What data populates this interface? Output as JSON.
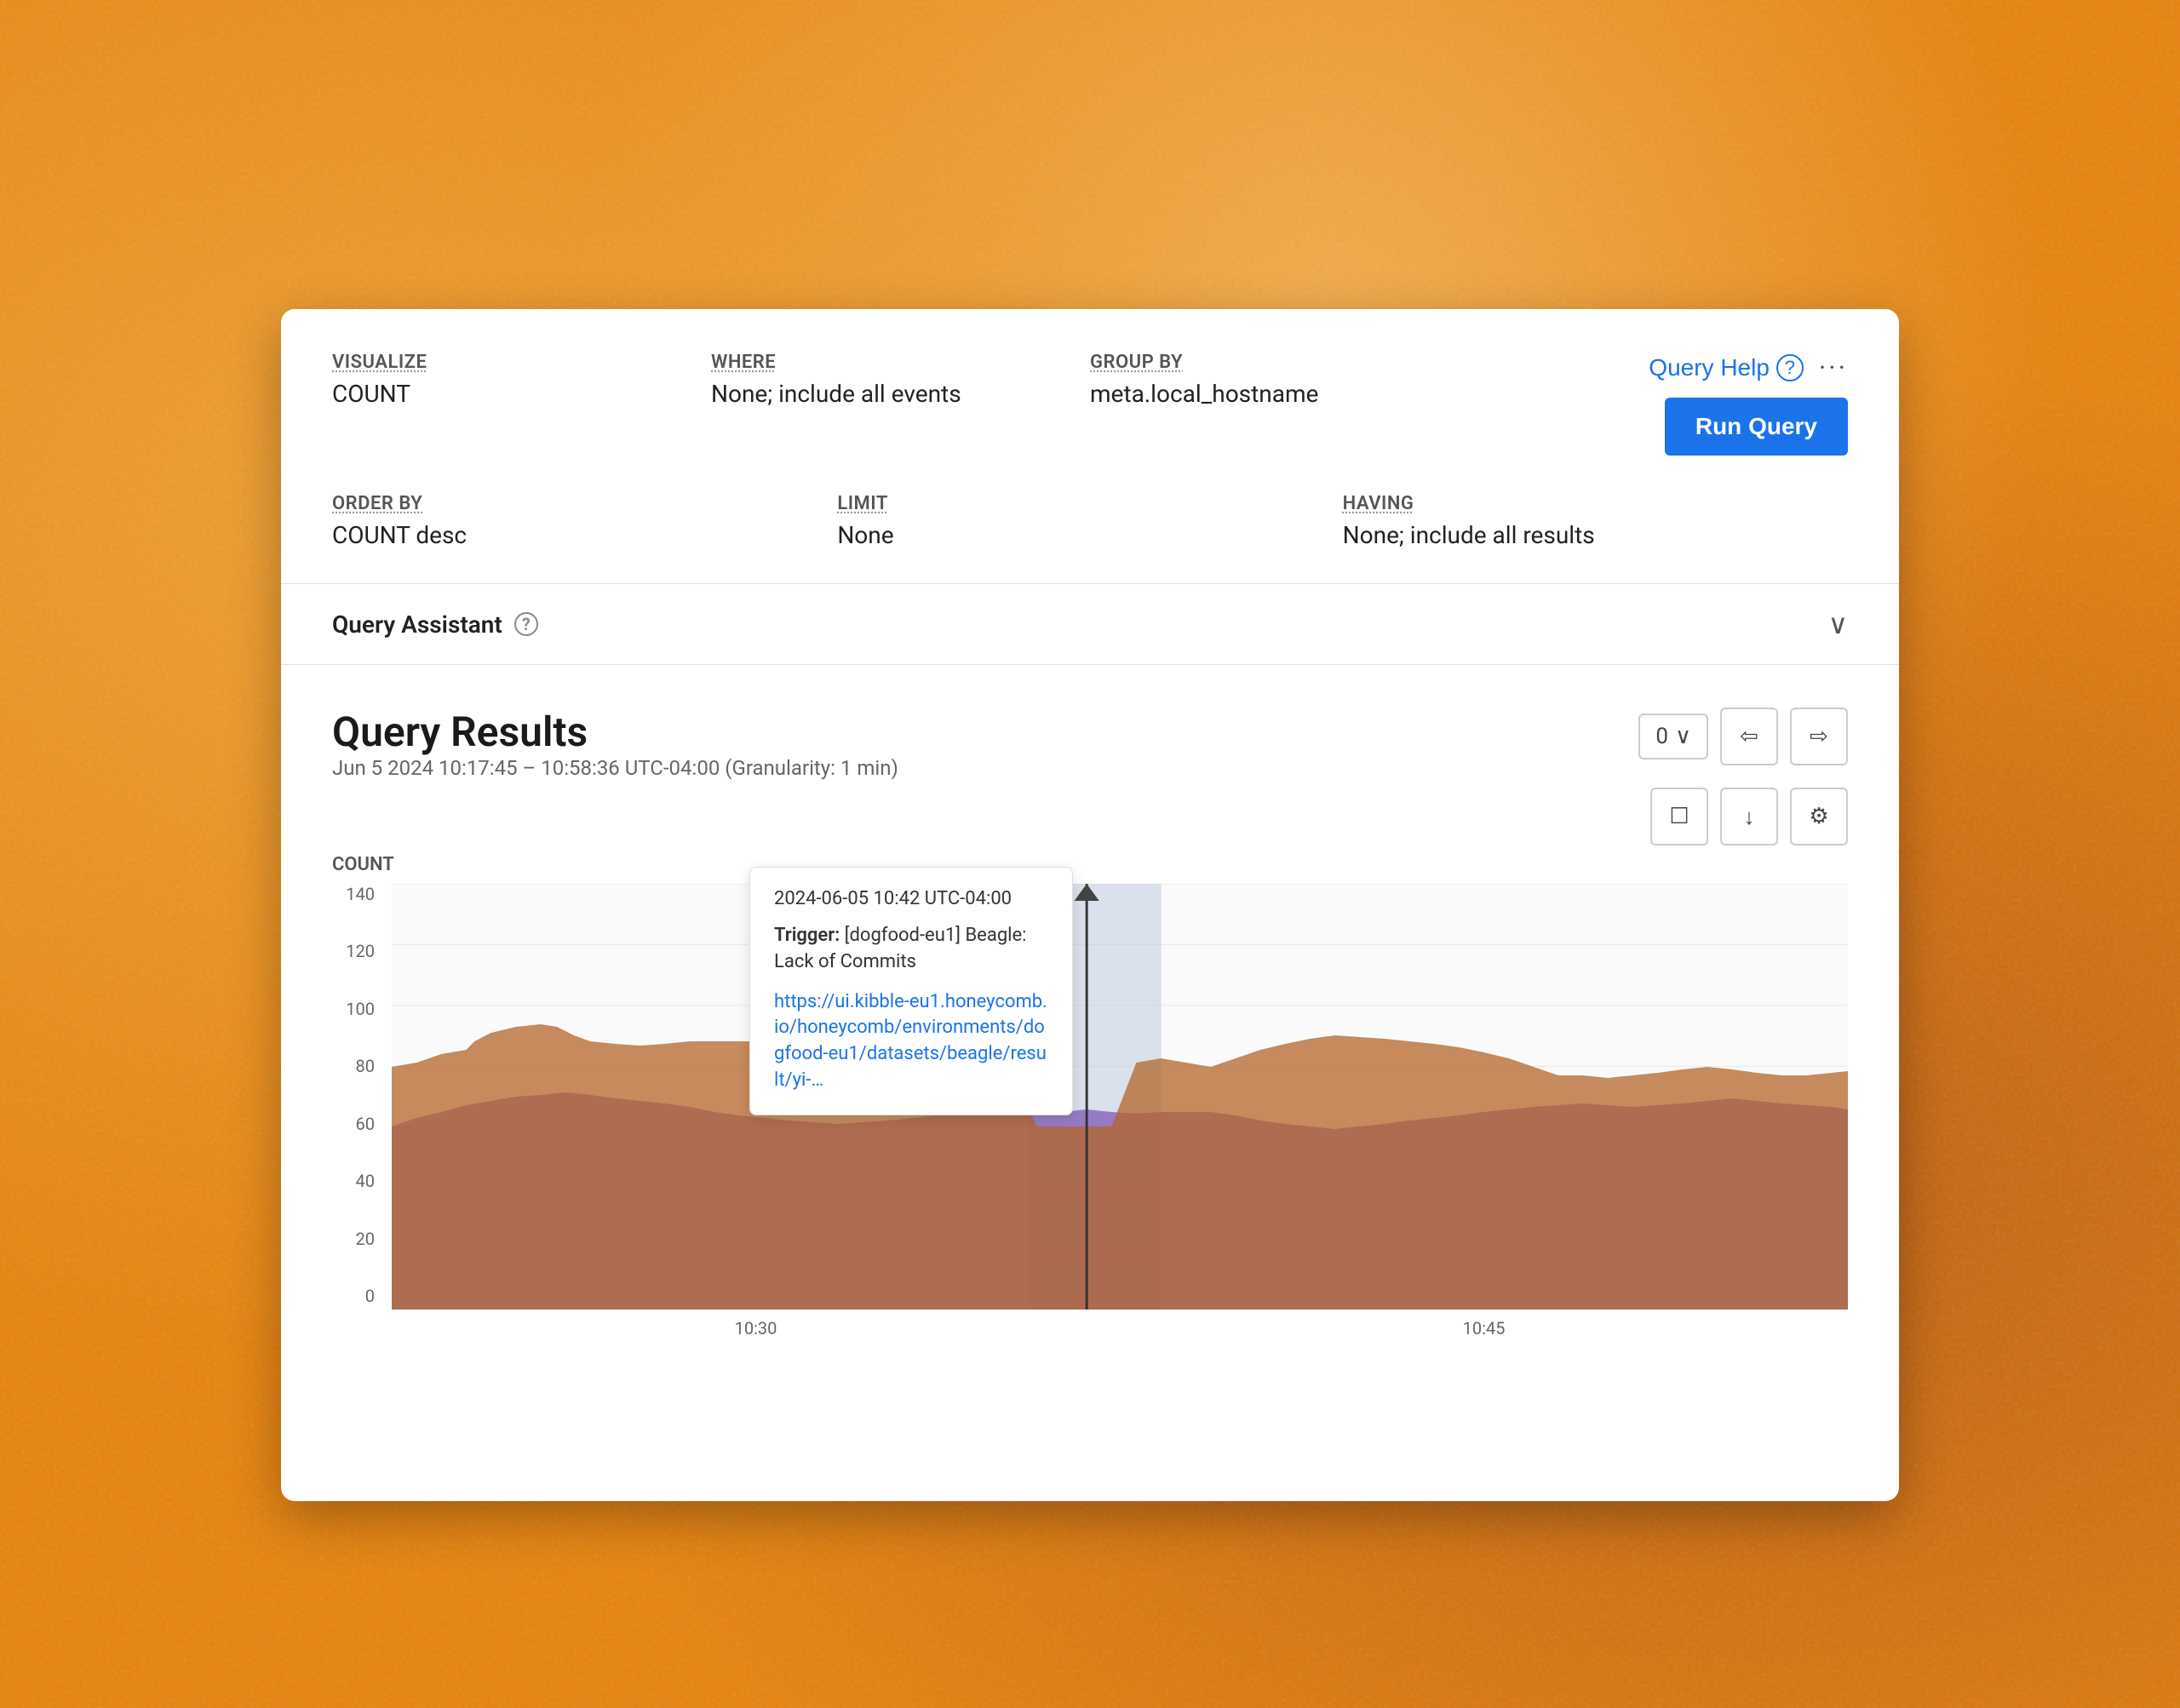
{
  "queryBuilder": {
    "visualize": {
      "label": "VISUALIZE",
      "value": "COUNT"
    },
    "where": {
      "label": "WHERE",
      "value": "None; include all events"
    },
    "groupBy": {
      "label": "GROUP BY",
      "value": "meta.local_hostname"
    },
    "orderBy": {
      "label": "ORDER BY",
      "value": "COUNT desc"
    },
    "limit": {
      "label": "LIMIT",
      "value": "None"
    },
    "having": {
      "label": "HAVING",
      "value": "None; include all results"
    },
    "queryHelp": "Query Help",
    "moreOptions": "···",
    "runQuery": "Run Query"
  },
  "queryAssistant": {
    "title": "Query Assistant",
    "helpIcon": "?"
  },
  "queryResults": {
    "title": "Query Results",
    "subtitle": "Jun 5 2024 10:17:45 – 10:58:36 UTC-04:00 (Granularity: 1 min)",
    "chartYLabel": "COUNT",
    "controls": {
      "pageSize": "0",
      "checkboxIcon": "☐",
      "downloadIcon": "↓",
      "settingsIcon": "⚙",
      "prevIcon": "◁",
      "nextIcon": "▷"
    }
  },
  "chart": {
    "yAxisTicks": [
      "0",
      "20",
      "40",
      "60",
      "80",
      "100",
      "120",
      "140"
    ],
    "xAxisTicks": [
      "10:30",
      "10:45"
    ],
    "markerPosition": 50,
    "highlightStart": 47,
    "highlightWidth": 10
  },
  "tooltip": {
    "time": "2024-06-05 10:42 UTC-04:00",
    "triggerLabel": "Trigger:",
    "triggerValue": "[dogfood-eu1] Beagle: Lack of Commits",
    "link": "https://ui.kibble-eu1.honeycomb.io/honeycomb/environments/dogfood-eu1/datasets/beagle/result/yi-…"
  }
}
